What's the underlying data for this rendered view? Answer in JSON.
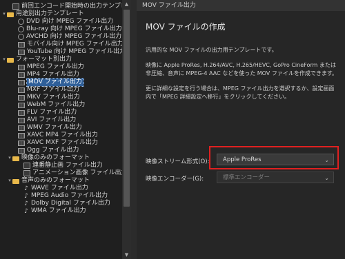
{
  "tree": [
    {
      "label": "前回エンコード開始時の出力テンプレート",
      "indent": 1,
      "icon": "file",
      "exp": ""
    },
    {
      "label": "用途別出力テンプレート",
      "indent": 0,
      "icon": "folder",
      "exp": "▾"
    },
    {
      "label": "DVD 向け MPEG ファイル出力",
      "indent": 2,
      "icon": "disc",
      "exp": ""
    },
    {
      "label": "Blu-ray 向け MPEG ファイル出力",
      "indent": 2,
      "icon": "disc",
      "exp": ""
    },
    {
      "label": "AVCHD 向け MPEG ファイル出力",
      "indent": 2,
      "icon": "disc",
      "exp": ""
    },
    {
      "label": "モバイル向け MPEG ファイル出力",
      "indent": 2,
      "icon": "film",
      "exp": ""
    },
    {
      "label": "YouTube 向け MPEG ファイル出力",
      "indent": 2,
      "icon": "film",
      "exp": ""
    },
    {
      "label": "フォーマット別出力",
      "indent": 0,
      "icon": "folder",
      "exp": "▾"
    },
    {
      "label": "MPEG ファイル出力",
      "indent": 2,
      "icon": "film",
      "exp": ""
    },
    {
      "label": "MP4 ファイル出力",
      "indent": 2,
      "icon": "film",
      "exp": ""
    },
    {
      "label": "MOV ファイル出力",
      "indent": 2,
      "icon": "film",
      "exp": "",
      "selected": true
    },
    {
      "label": "MXF ファイル出力",
      "indent": 2,
      "icon": "film",
      "exp": ""
    },
    {
      "label": "MKV ファイル出力",
      "indent": 2,
      "icon": "film",
      "exp": ""
    },
    {
      "label": "WebM ファイル出力",
      "indent": 2,
      "icon": "film",
      "exp": ""
    },
    {
      "label": "FLV ファイル出力",
      "indent": 2,
      "icon": "film",
      "exp": ""
    },
    {
      "label": "AVI ファイル出力",
      "indent": 2,
      "icon": "film",
      "exp": ""
    },
    {
      "label": "WMV ファイル出力",
      "indent": 2,
      "icon": "film",
      "exp": ""
    },
    {
      "label": "XAVC MP4 ファイル出力",
      "indent": 2,
      "icon": "film",
      "exp": ""
    },
    {
      "label": "XAVC MXF ファイル出力",
      "indent": 2,
      "icon": "film",
      "exp": ""
    },
    {
      "label": "Ogg ファイル出力",
      "indent": 2,
      "icon": "film",
      "exp": ""
    },
    {
      "label": "映像のみのフォーマット",
      "indent": 1,
      "icon": "folder",
      "exp": "▾"
    },
    {
      "label": "連番静止画 ファイル出力",
      "indent": 3,
      "icon": "file",
      "exp": ""
    },
    {
      "label": "アニメーション画像 ファイル出力",
      "indent": 3,
      "icon": "file",
      "exp": ""
    },
    {
      "label": "音声のみのフォーマット",
      "indent": 1,
      "icon": "folder",
      "exp": "▾"
    },
    {
      "label": "WAVE ファイル出力",
      "indent": 3,
      "icon": "note",
      "exp": ""
    },
    {
      "label": "MPEG Audio ファイル出力",
      "indent": 3,
      "icon": "note",
      "exp": ""
    },
    {
      "label": "Dolby Digital ファイル出力",
      "indent": 3,
      "icon": "note",
      "exp": ""
    },
    {
      "label": "WMA ファイル出力",
      "indent": 3,
      "icon": "note",
      "exp": ""
    }
  ],
  "panel": {
    "header": "MOV ファイル出力",
    "title": "MOV ファイルの作成",
    "desc1": "汎用的な MOV ファイルの出力用テンプレートです。",
    "desc2": "映像に Apple ProRes, H.264/AVC, H.265/HEVC, GoPro CineForm または 非圧縮、音声に MPEG-4 AAC などを使った MOV ファイルを作成できます。",
    "desc3": "更に詳細な設定を行う場合は、MPEG ファイル出力を選択するか、設定画面内で「MPEG 詳細設定へ移行」をクリックしてください。",
    "stream_label": "映像ストリーム形式(O):",
    "stream_value": "Apple ProRes",
    "encoder_label": "映像エンコーダー(G):",
    "encoder_value": "標準エンコーダー"
  }
}
